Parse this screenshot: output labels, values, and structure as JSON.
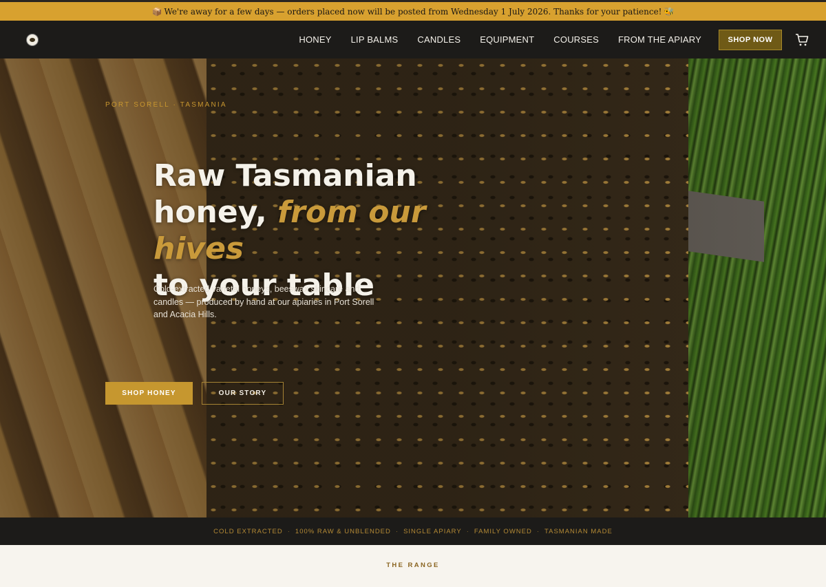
{
  "announcement": {
    "icon_left": "package-icon",
    "text": "We're away for a few days — orders placed now will be posted from Wednesday 1 July 2026. Thanks for your patience!",
    "icon_right": "bee-icon"
  },
  "header": {
    "logo": "bee-logo",
    "nav": [
      {
        "label": "HONEY"
      },
      {
        "label": "LIP BALMS"
      },
      {
        "label": "CANDLES"
      },
      {
        "label": "EQUIPMENT"
      },
      {
        "label": "COURSES"
      },
      {
        "label": "FROM THE APIARY"
      }
    ],
    "cta_label": "SHOP NOW",
    "cart_icon": "cart-icon"
  },
  "hero": {
    "eyebrow": "PORT SORELL · TASMANIA",
    "title_line1": "Raw Tasmanian",
    "title_line2_prefix": "honey, ",
    "title_line2_accent": "from our hives",
    "title_line3": "to your table",
    "description": "Cold-extracted varietal honeys, beeswax skincare and candles — produced by hand at our apiaries in Port Sorell and Acacia Hills.",
    "primary_button": "SHOP HONEY",
    "secondary_button": "OUR STORY"
  },
  "trust_strip": {
    "items": [
      "COLD EXTRACTED",
      "100% RAW & UNBLENDED",
      "SINGLE APIARY",
      "FAMILY OWNED",
      "TASMANIAN MADE"
    ],
    "separator": "·"
  },
  "range": {
    "title": "THE RANGE"
  },
  "colors": {
    "announcement_bg": "#d8a12f",
    "nav_bg": "#1c1b19",
    "accent_gold": "#c6972f",
    "shop_now_bg": "#6f5a16"
  }
}
